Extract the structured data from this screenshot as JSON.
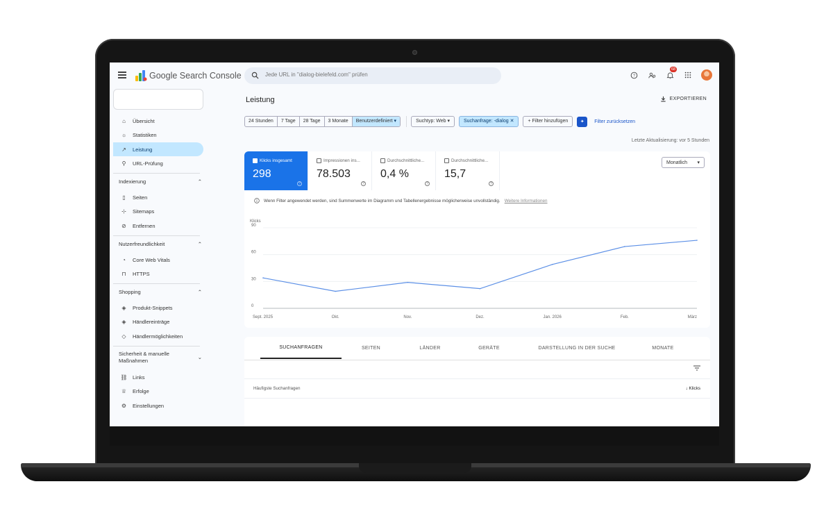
{
  "app": {
    "brand": "Google Search Console"
  },
  "search": {
    "placeholder": "Jede URL in \"dialog-bielefeld.com\" prüfen"
  },
  "notifications": {
    "count": "68"
  },
  "sidebar": {
    "items_top": [
      {
        "label": "Übersicht",
        "icon": "home-icon"
      },
      {
        "label": "Statistiken",
        "icon": "bulb-icon"
      },
      {
        "label": "Leistung",
        "icon": "trending-icon"
      },
      {
        "label": "URL-Prüfung",
        "icon": "search-icon"
      }
    ],
    "sections": [
      {
        "title": "Indexierung",
        "items": [
          "Seiten",
          "Sitemaps",
          "Entfernen"
        ]
      },
      {
        "title": "Nutzerfreundlichkeit",
        "items": [
          "Core Web Vitals",
          "HTTPS"
        ]
      },
      {
        "title": "Shopping",
        "items": [
          "Produkt-Snippets",
          "Händlereinträge",
          "Händlermöglichkeiten"
        ]
      },
      {
        "title": "Sicherheit & manuelle Maßnahmen",
        "items": [
          "Links",
          "Erfolge",
          "Einstellungen"
        ]
      }
    ]
  },
  "main": {
    "title": "Leistung",
    "export_label": "EXPORTIEREN",
    "date_ranges": [
      "24 Stunden",
      "7 Tage",
      "28 Tage",
      "3 Monate",
      "Benutzerdefiniert"
    ],
    "search_type": "Suchtyp: Web",
    "query_filter": "Suchanfrage: -dialog",
    "add_filter": "Filter hinzufügen",
    "reset_filters": "Filter zurücksetzen",
    "last_update": "Letzte Aktualisierung: vor 5 Stunden",
    "metrics": [
      {
        "label": "Klicks insgesamt",
        "value": "298",
        "selected": true
      },
      {
        "label": "Impressionen ins...",
        "value": "78.503",
        "selected": false
      },
      {
        "label": "Durchschnittliche...",
        "value": "0,4 %",
        "selected": false
      },
      {
        "label": "Durchschnittliche...",
        "value": "15,7",
        "selected": false
      }
    ],
    "granularity": "Monatlich",
    "info_text": "Wenn Filter angewendet werden, sind Summenwerte im Diagramm und Tabellenergebnisse möglicherweise unvollständig.",
    "info_link": "Weitere Informationen",
    "tabs": [
      "SUCHANFRAGEN",
      "SEITEN",
      "LÄNDER",
      "GERÄTE",
      "DARSTELLUNG IN DER SUCHE",
      "MONATE"
    ],
    "table": {
      "left_header": "Häufigste Suchanfragen",
      "right_header": "Klicks"
    }
  },
  "chart_data": {
    "type": "line",
    "ylabel": "Klicks",
    "ylim": [
      0,
      90
    ],
    "yticks": [
      0,
      30,
      60,
      90
    ],
    "x_labels": [
      "Sept. 2025",
      "Okt.",
      "Nov.",
      "Dez.",
      "Jan. 2026",
      "Feb.",
      "März"
    ],
    "series": [
      {
        "values": [
          34,
          19,
          29,
          22,
          49,
          69,
          76
        ],
        "color": "#5b8fe6"
      }
    ]
  }
}
